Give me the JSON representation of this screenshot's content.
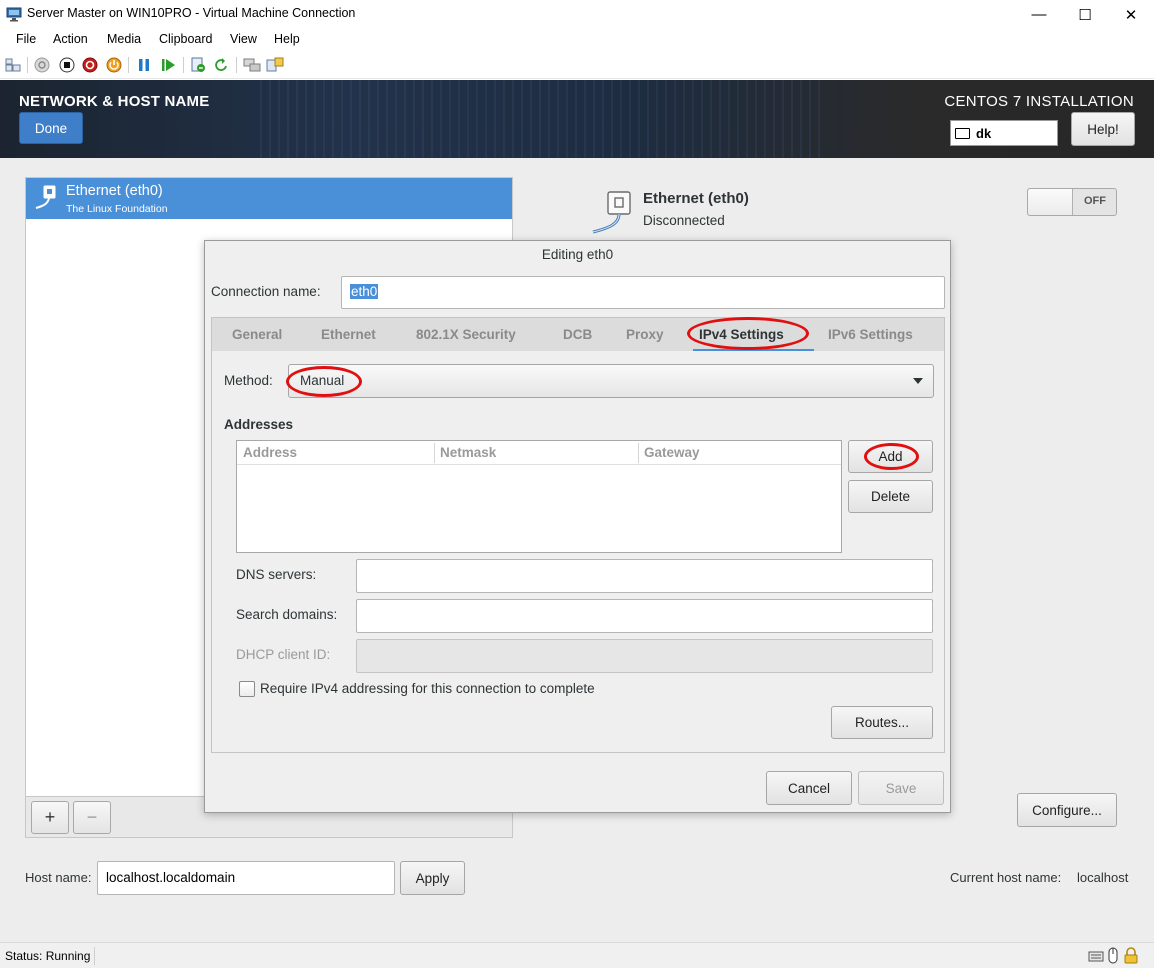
{
  "window": {
    "title": "Server Master on WIN10PRO - Virtual Machine Connection",
    "controls": {
      "minimize": "—",
      "maximize": "☐",
      "close": "✕"
    }
  },
  "menubar": {
    "items": [
      "File",
      "Action",
      "Media",
      "Clipboard",
      "View",
      "Help"
    ]
  },
  "toolbar": {
    "icons": [
      "ctrl-alt-del-icon",
      "start-icon",
      "turn-off-icon",
      "shutdown-icon",
      "power-icon",
      "pause-icon",
      "resume-icon",
      "checkpoint-icon",
      "revert-icon",
      "enhanced-session-icon",
      "share-icon"
    ]
  },
  "installer": {
    "header": {
      "title": "NETWORK & HOST NAME",
      "done_label": "Done",
      "product_title": "CENTOS 7 INSTALLATION",
      "keyboard_layout": "dk",
      "help_label": "Help!"
    },
    "device_list": {
      "items": [
        {
          "name": "Ethernet (eth0)",
          "vendor": "The Linux Foundation",
          "selected": true
        }
      ],
      "add_label": "+",
      "remove_label": "−"
    },
    "device_detail": {
      "name": "Ethernet (eth0)",
      "status": "Disconnected",
      "toggle_label": "OFF",
      "configure_label": "Configure..."
    },
    "hostname": {
      "label": "Host name:",
      "value": "localhost.localdomain",
      "apply_label": "Apply",
      "current_label": "Current host name:",
      "current_value": "localhost"
    }
  },
  "dialog": {
    "title": "Editing eth0",
    "connection_name_label": "Connection name:",
    "connection_name_value": "eth0",
    "tabs": [
      "General",
      "Ethernet",
      "802.1X Security",
      "DCB",
      "Proxy",
      "IPv4 Settings",
      "IPv6 Settings"
    ],
    "active_tab": "IPv4 Settings",
    "method_label": "Method:",
    "method_value": "Manual",
    "addresses_heading": "Addresses",
    "address_columns": [
      "Address",
      "Netmask",
      "Gateway"
    ],
    "add_label": "Add",
    "delete_label": "Delete",
    "dns_label": "DNS servers:",
    "dns_value": "",
    "search_label": "Search domains:",
    "search_value": "",
    "dhcp_label": "DHCP client ID:",
    "dhcp_value": "",
    "require_label": "Require IPv4 addressing for this connection to complete",
    "require_checked": false,
    "routes_label": "Routes...",
    "cancel_label": "Cancel",
    "save_label": "Save"
  },
  "statusbar": {
    "text": "Status: Running"
  },
  "colors": {
    "selection_blue": "#4a90d9",
    "annotation_red": "#e01010"
  }
}
